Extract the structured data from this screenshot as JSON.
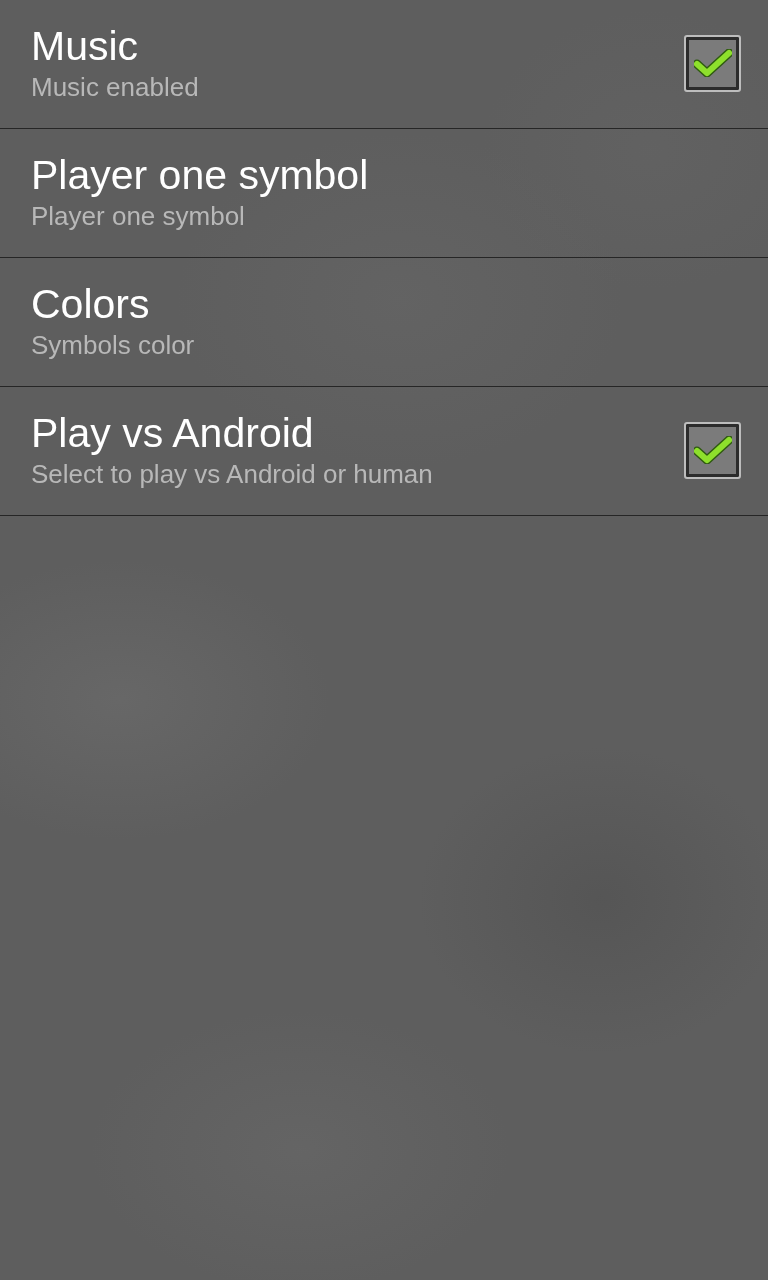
{
  "preferences": [
    {
      "kind": "checkbox",
      "title": "Music",
      "summary": "Music enabled",
      "checked": true
    },
    {
      "kind": "plain",
      "title": "Player one symbol",
      "summary": "Player one symbol"
    },
    {
      "kind": "plain",
      "title": "Colors",
      "summary": "Symbols color"
    },
    {
      "kind": "checkbox",
      "title": "Play vs Android",
      "summary": "Select to play vs Android or human",
      "checked": true
    }
  ]
}
